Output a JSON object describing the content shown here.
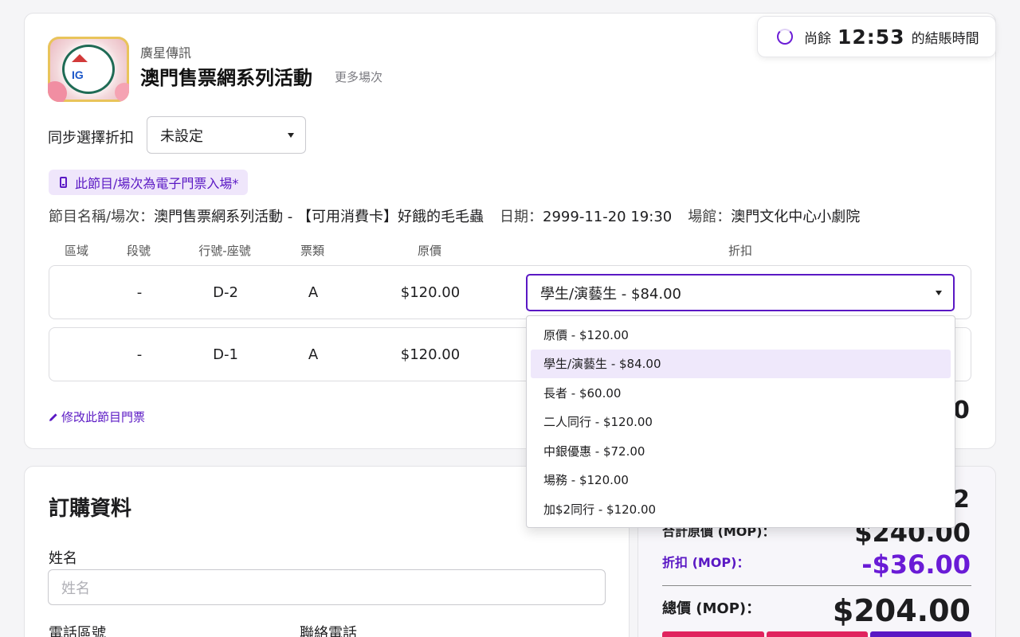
{
  "timer": {
    "prefix": "尚餘",
    "time": "12:53",
    "suffix": "的結賬時間"
  },
  "event": {
    "organizer": "廣星傳訊",
    "title": "澳門售票網系列活動",
    "more_sessions": "更多場次"
  },
  "sync_discount": {
    "label": "同步選擇折扣",
    "value": "未設定"
  },
  "eticket_notice": "此節目/場次為電子門票入場*",
  "info": {
    "program_label": "節目名稱/場次：",
    "program_value": "澳門售票網系列活動 - 【可用消費卡】好餓的毛毛蟲",
    "date_label": "日期：",
    "date_value": "2999-11-20 19:30",
    "venue_label": "場館：",
    "venue_value": "澳門文化中心小劇院"
  },
  "table": {
    "headers": {
      "zone": "區域",
      "section": "段號",
      "seat": "行號-座號",
      "type": "票類",
      "price": "原價",
      "discount": "折扣"
    },
    "rows": [
      {
        "zone": "",
        "section": "-",
        "seat": "D-2",
        "type": "A",
        "price": "$120.00",
        "discount": "學生/演藝生 - $84.00"
      },
      {
        "zone": "",
        "section": "-",
        "seat": "D-1",
        "type": "A",
        "price": "$120.00",
        "discount": ""
      }
    ]
  },
  "discount_options": [
    {
      "label": "原價 - $120.00",
      "selected": false
    },
    {
      "label": "學生/演藝生 - $84.00",
      "selected": true
    },
    {
      "label": "長者 - $60.00",
      "selected": false
    },
    {
      "label": "二人同行 - $120.00",
      "selected": false
    },
    {
      "label": "中銀優惠 - $72.00",
      "selected": false
    },
    {
      "label": "場務 - $120.00",
      "selected": false
    },
    {
      "label": "加$2同行 - $120.00",
      "selected": false
    }
  ],
  "edit_link": "修改此節目門票",
  "partial_subtotal": "0",
  "order": {
    "title": "訂購資料",
    "name_label": "姓名",
    "name_placeholder": "姓名",
    "phone_code_label": "電話區號",
    "phone_label": "聯絡電話"
  },
  "summary": {
    "ticket_count": "2",
    "original_label": "合計原價 (MOP)：",
    "original_value": "$240.00",
    "discount_label": "折扣 (MOP)：",
    "discount_value": "-$36.00",
    "total_label": "總價 (MOP)：",
    "total_value": "$204.00"
  },
  "colors": {
    "accent": "#5a18c4",
    "discount": "#6a1bd6",
    "pay_red": "#e0245e",
    "pay_purple": "#5a18c4"
  },
  "icons": {
    "timer": "loading-ring-icon",
    "eticket": "phone-icon",
    "edit": "pencil-icon",
    "caret": "caret-down-icon"
  }
}
